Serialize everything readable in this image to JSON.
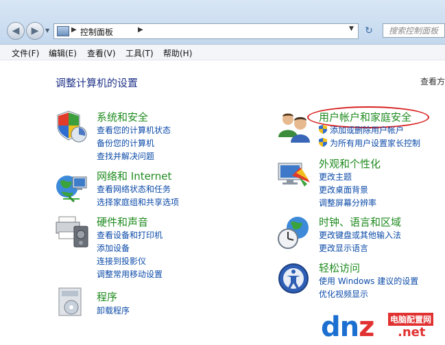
{
  "address": {
    "crumb": "控制面板",
    "search_placeholder": "搜索控制面板"
  },
  "menu": [
    "文件(F)",
    "编辑(E)",
    "查看(V)",
    "工具(T)",
    "帮助(H)"
  ],
  "page_title": "调整计算机的设置",
  "view_by": "查看方",
  "categories": [
    {
      "title": "系统和安全",
      "links": [
        "查看您的计算机状态",
        "备份您的计算机",
        "查找并解决问题"
      ]
    },
    {
      "title": "网络和 Internet",
      "links": [
        "查看网络状态和任务",
        "选择家庭组和共享选项"
      ]
    },
    {
      "title": "硬件和声音",
      "links": [
        "查看设备和打印机",
        "添加设备",
        "连接到投影仪",
        "调整常用移动设置"
      ]
    },
    {
      "title": "程序",
      "links": [
        "卸载程序"
      ]
    },
    {
      "title": "用户帐户和家庭安全",
      "links": [
        "添加或删除用户帐户",
        "为所有用户设置家长控制"
      ]
    },
    {
      "title": "外观和个性化",
      "links": [
        "更改主题",
        "更改桌面背景",
        "调整屏幕分辨率"
      ]
    },
    {
      "title": "时钟、语言和区域",
      "links": [
        "更改键盘或其他输入法",
        "更改显示语言"
      ]
    },
    {
      "title": "轻松访问",
      "links": [
        "使用 Windows 建议的设置",
        "优化视频显示"
      ]
    }
  ],
  "colors": {
    "title_blue": "#1e3287",
    "category_green": "#1e8a1e",
    "link_blue": "#0b4aa8",
    "annotation_red": "#d82020"
  },
  "watermark": {
    "letters_a": "dn",
    "letters_z": "z",
    "site": "电脑配置网",
    "tld": ".net"
  }
}
